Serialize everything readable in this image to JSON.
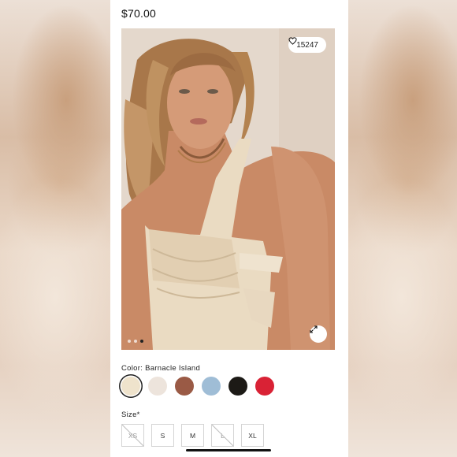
{
  "product": {
    "price": "$70.00"
  },
  "gallery": {
    "like_count": "15247",
    "like_icon": "heart-icon",
    "expand_icon": "expand-arrows-icon",
    "total_images": 3,
    "active_image": 3
  },
  "color": {
    "label": "Color: Barnacle Island",
    "swatches": [
      {
        "color": "#efe3cc",
        "selected": true
      },
      {
        "color": "#ede4dc",
        "selected": false
      },
      {
        "color": "#9a5a45",
        "selected": false
      },
      {
        "color": "#9fbdd6",
        "selected": false
      },
      {
        "color": "#1c1a16",
        "selected": false
      },
      {
        "color": "#d92235",
        "selected": false
      }
    ]
  },
  "size": {
    "label": "Size*",
    "options": [
      {
        "label": "XS",
        "available": false
      },
      {
        "label": "S",
        "available": true
      },
      {
        "label": "M",
        "available": true
      },
      {
        "label": "L",
        "available": false
      },
      {
        "label": "XL",
        "available": true
      }
    ]
  }
}
